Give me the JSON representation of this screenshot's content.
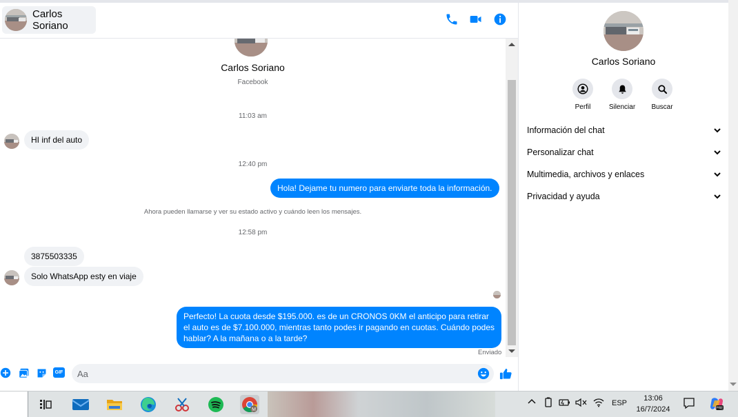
{
  "chat_header": {
    "contact_name": "Carlos Soriano",
    "icons": [
      "phone-icon",
      "video-icon",
      "info-icon"
    ]
  },
  "chat": {
    "profile_name": "Carlos Soriano",
    "profile_source": "Facebook",
    "messages": [
      {
        "type": "timestamp",
        "text": "11:03 am"
      },
      {
        "type": "incoming",
        "text": "HI inf del auto"
      },
      {
        "type": "timestamp",
        "text": "12:40 pm"
      },
      {
        "type": "outgoing",
        "text": "Hola! Dejame tu numero  para enviarte toda la información."
      },
      {
        "type": "system",
        "text": "Ahora pueden llamarse y ver su estado activo y cuándo leen los mensajes."
      },
      {
        "type": "timestamp",
        "text": "12:58 pm"
      },
      {
        "type": "incoming",
        "text": "3875503335"
      },
      {
        "type": "incoming",
        "text": "Solo WhatsApp esty en viaje"
      },
      {
        "type": "outgoing",
        "text": "Perfecto! La cuota desde $195.000. es de un CRONOS 0KM el anticipo para retirar el auto es de $7.100.000, mientras tanto podes ir pagando en cuotas. Cuándo podes hablar? A la mañana o a la tarde?"
      }
    ],
    "status": "Enviado"
  },
  "composer": {
    "placeholder": "Aa",
    "icons": [
      "plus-icon",
      "image-icon",
      "sticker-icon",
      "gif-icon",
      "emoji-icon",
      "like-icon"
    ],
    "gif_label": "GIF"
  },
  "info_panel": {
    "name": "Carlos Soriano",
    "actions": [
      {
        "label": "Perfil",
        "icon": "profile-icon"
      },
      {
        "label": "Silenciar",
        "icon": "bell-icon"
      },
      {
        "label": "Buscar",
        "icon": "search-icon"
      }
    ],
    "sections": [
      {
        "label": "Información del chat"
      },
      {
        "label": "Personalizar chat"
      },
      {
        "label": "Multimedia, archivos y enlaces"
      },
      {
        "label": "Privacidad y ayuda"
      }
    ]
  },
  "taskbar": {
    "apps": [
      "task-view-icon",
      "mail-icon",
      "file-explorer-icon",
      "edge-icon",
      "snipping-tool-icon",
      "spotify-icon",
      "chrome-icon"
    ],
    "language": "ESP",
    "time": "13:06",
    "date": "16/7/2024",
    "colors": {
      "messenger_blue": "#0084ff",
      "spotify_green": "#1db954"
    }
  }
}
